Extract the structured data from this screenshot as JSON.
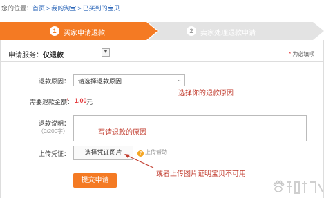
{
  "breadcrumb": {
    "prefix": "您的位置：",
    "home": "首页",
    "sep1": ">",
    "my_taobao": "我的淘宝",
    "sep2": ">",
    "bought": "已买到的宝贝"
  },
  "steps": [
    {
      "num": "1",
      "label": "买家申请退款",
      "active": true
    },
    {
      "num": "2",
      "label": "卖家处理退款申请",
      "active": false
    }
  ],
  "service": {
    "label": "申请服务：",
    "value": "仅退款",
    "dropdown_icon": "chevron-down-icon"
  },
  "required_note": {
    "star": "*",
    "text": "为必填项"
  },
  "form": {
    "reason_label": "退款原因：",
    "reason_placeholder": "请选择退款原因",
    "amount_label": "需要退款金额：",
    "amount_star": "*",
    "amount_value": "1.00",
    "amount_unit": "元",
    "desc_label": "退款说明：",
    "desc_counter": "（0/200字）",
    "upload_label": "上传凭证：",
    "upload_button": "选择凭证图片",
    "upload_help": "上传帮助",
    "submit": "提交申请"
  },
  "annotations": {
    "reason": "选择你的退款原因",
    "desc": "写请退款的原因",
    "upload": "或者上传图片证明宝贝不可用"
  },
  "colors": {
    "accent": "#f47a23",
    "link": "#2a65b8",
    "annotation": "#c0392b",
    "price": "#e4393c"
  }
}
